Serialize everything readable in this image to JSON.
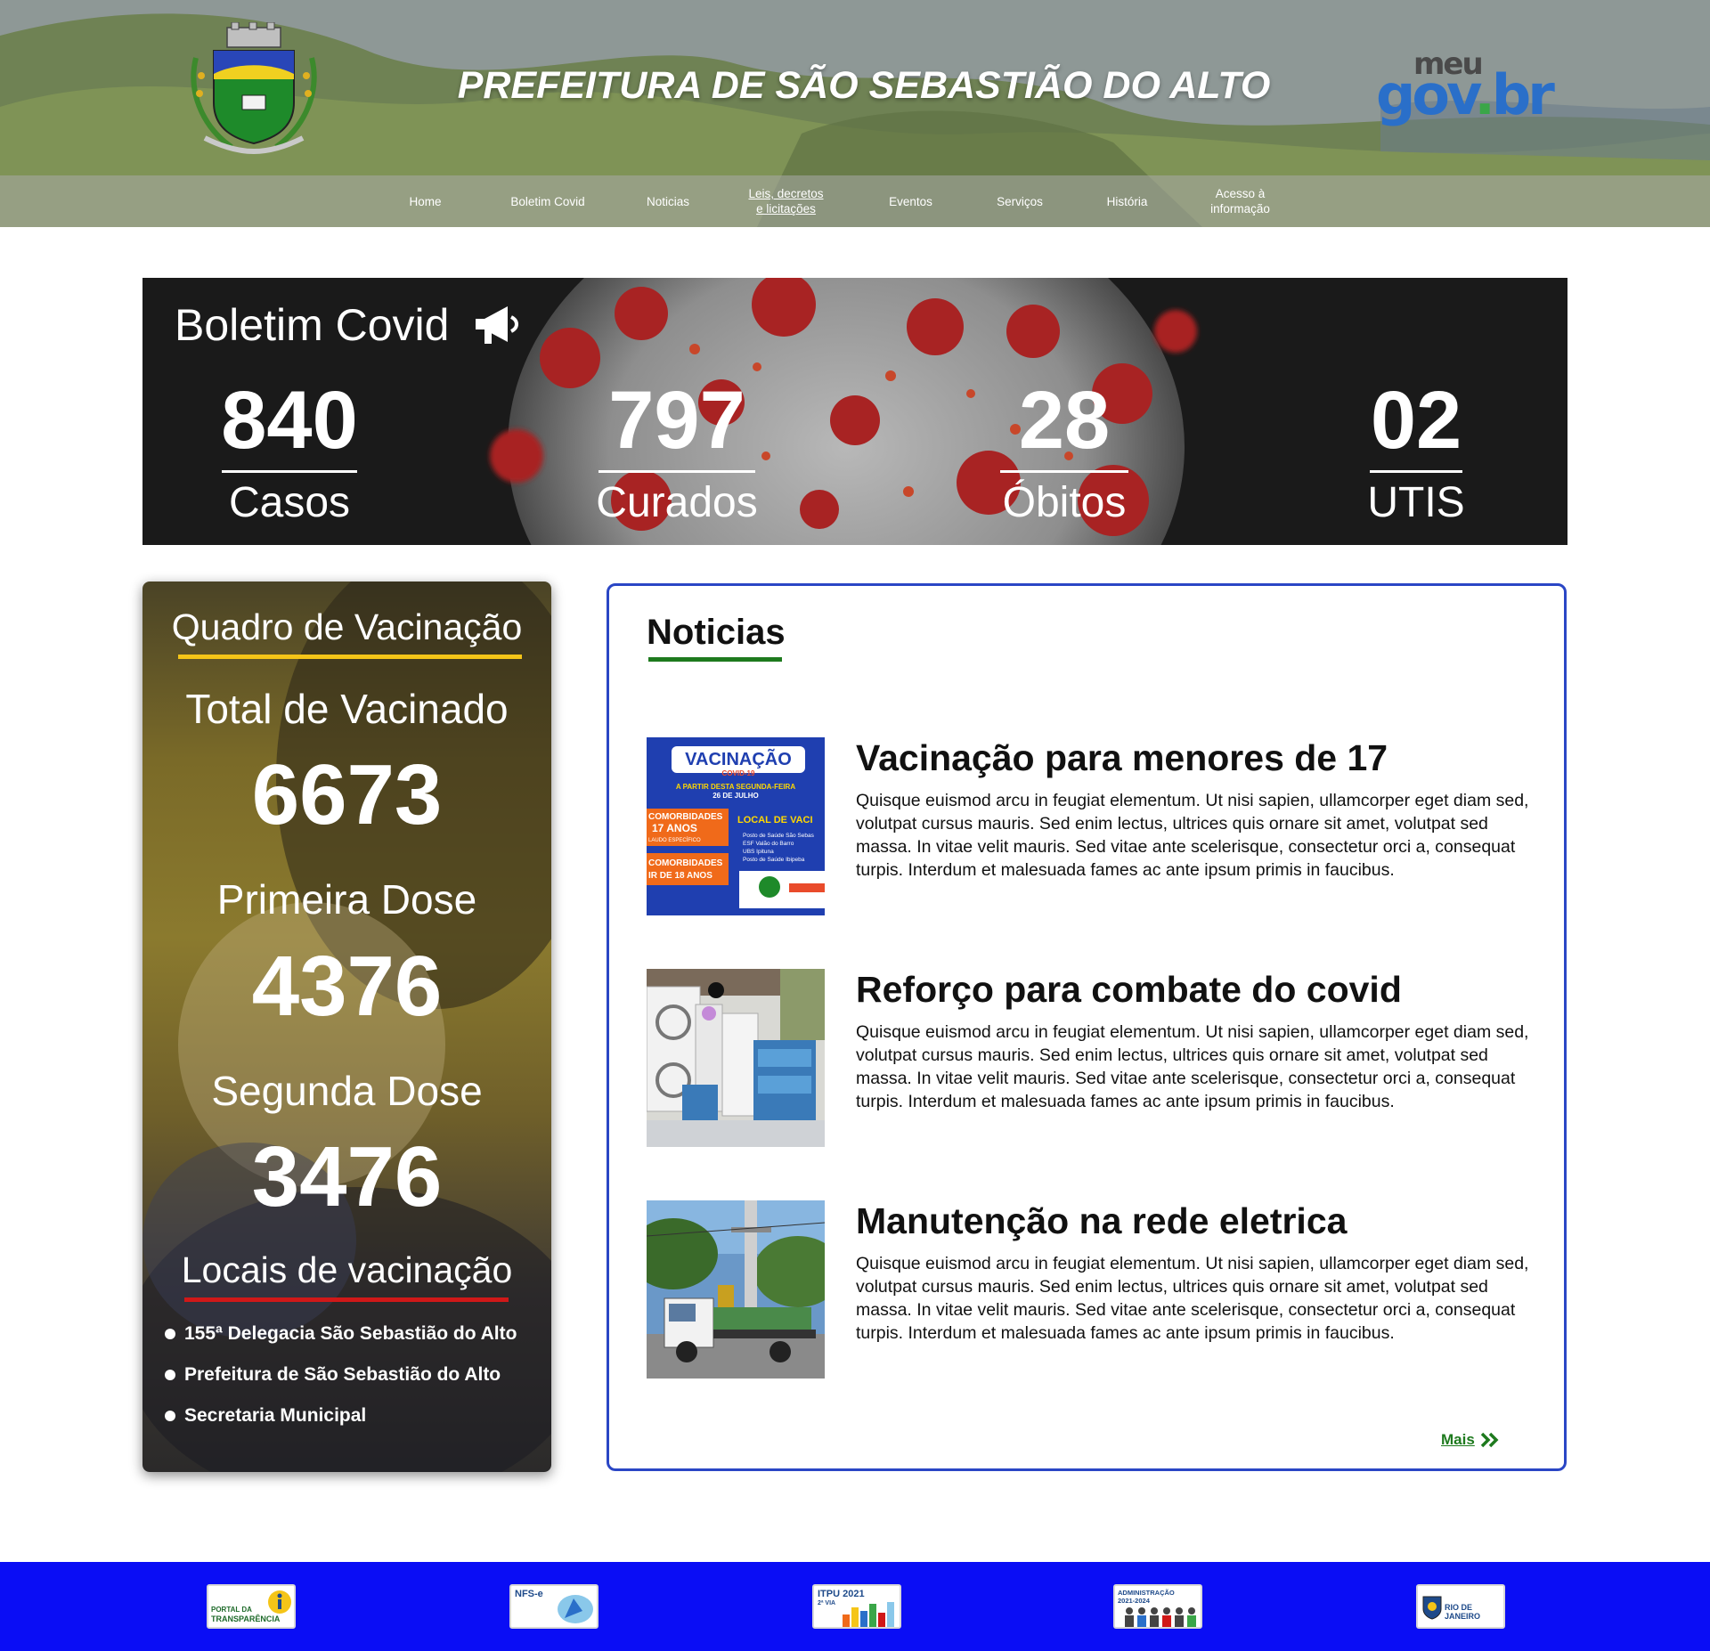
{
  "header": {
    "site_title": "PREFEITURA DE SÃO SEBASTIÃO DO ALTO",
    "govbr_meu": "meu",
    "govbr_gov": "gov",
    "govbr_dot": ".",
    "govbr_br": "br"
  },
  "nav": {
    "items": [
      {
        "label": "Home"
      },
      {
        "label": "Boletim Covid"
      },
      {
        "label": "Noticias"
      },
      {
        "label_line1": "Leis, decretos",
        "label_line2": "e licitações"
      },
      {
        "label": "Eventos"
      },
      {
        "label": "Serviços"
      },
      {
        "label": "História"
      },
      {
        "label_line1": "Acesso à",
        "label_line2": "informação"
      }
    ]
  },
  "covid": {
    "title": "Boletim Covid",
    "stats": [
      {
        "value": "840",
        "label": "Casos"
      },
      {
        "value": "797",
        "label": "Curados"
      },
      {
        "value": "28",
        "label": "Óbitos"
      },
      {
        "value": "02",
        "label": "UTIS"
      }
    ]
  },
  "vaccination": {
    "title": "Quadro de Vacinação",
    "total_label": "Total de Vacinado",
    "total_value": "6673",
    "first_label": "Primeira Dose",
    "first_value": "4376",
    "second_label": "Segunda Dose",
    "second_value": "3476",
    "locations_title": "Locais de vacinação",
    "locations": [
      "155ª Delegacia São Sebastião do Alto",
      "Prefeitura de São Sebastião do Alto",
      "Secretaria Municipal"
    ],
    "colors": {
      "title_underline": "#f5c518",
      "locations_underline": "#d01818"
    }
  },
  "news": {
    "title": "Noticias",
    "items": [
      {
        "headline": "Vacinação para menores de 17",
        "body": "Quisque euismod arcu in feugiat elementum. Ut nisi sapien, ullamcorper eget diam sed, volutpat cursus mauris. Sed enim lectus, ultrices quis ornare sit amet, volutpat sed massa. In vitae velit mauris. Sed vitae ante scelerisque, consectetur orci a, consequat turpis. Interdum et malesuada fames ac ante ipsum primis in faucibus.",
        "poster": {
          "title": "VACINAÇÃO",
          "subtitle": "COVID-19",
          "line1": "A PARTIR DESTA SEGUNDA-FEIRA",
          "line2": "26 DE JULHO",
          "box1_a": "COMORBIDADES",
          "box1_b": "17 ANOS",
          "box1_c": "LAUDO ESPECÍFICO",
          "box2_a": "COMORBIDADES",
          "box2_b": "IR DE 18 ANOS",
          "local": "LOCAL DE VACI",
          "places": [
            "Posto de Saúde São Sebas",
            "ESF Valão do Barro",
            "UBS Ipituna",
            "Posto de Saúde Ibipeba"
          ]
        }
      },
      {
        "headline": "Reforço para combate do covid",
        "body": "Quisque euismod arcu in feugiat elementum. Ut nisi sapien, ullamcorper eget diam sed, volutpat cursus mauris. Sed enim lectus, ultrices quis ornare sit amet, volutpat sed massa. In vitae velit mauris. Sed vitae ante scelerisque, consectetur orci a, consequat turpis. Interdum et malesuada fames ac ante ipsum primis in faucibus."
      },
      {
        "headline": "Manutenção na rede eletrica",
        "body": "Quisque euismod arcu in feugiat elementum. Ut nisi sapien, ullamcorper eget diam sed, volutpat cursus mauris. Sed enim lectus, ultrices quis ornare sit amet, volutpat sed massa. In vitae velit mauris. Sed vitae ante scelerisque, consectetur orci a, consequat turpis. Interdum et malesuada fames ac ante ipsum primis in faucibus."
      }
    ],
    "more_label": "Mais",
    "colors": {
      "border": "#2a46c5",
      "title_underline": "#1e7a1e",
      "more": "#1e7a1e"
    }
  },
  "footer": {
    "logos": [
      {
        "line1": "PORTAL DA",
        "line2": "TRANSPARÊNCIA"
      },
      {
        "line1": "NFS-e"
      },
      {
        "line1": "ITPU 2021",
        "line2": "2ª VIA"
      },
      {
        "line1": "ADMINISTRAÇÃO",
        "line2": "2021-2024"
      },
      {
        "line1": "RIO DE JANEIRO"
      }
    ],
    "colors": {
      "background": "#0a0df5"
    }
  }
}
